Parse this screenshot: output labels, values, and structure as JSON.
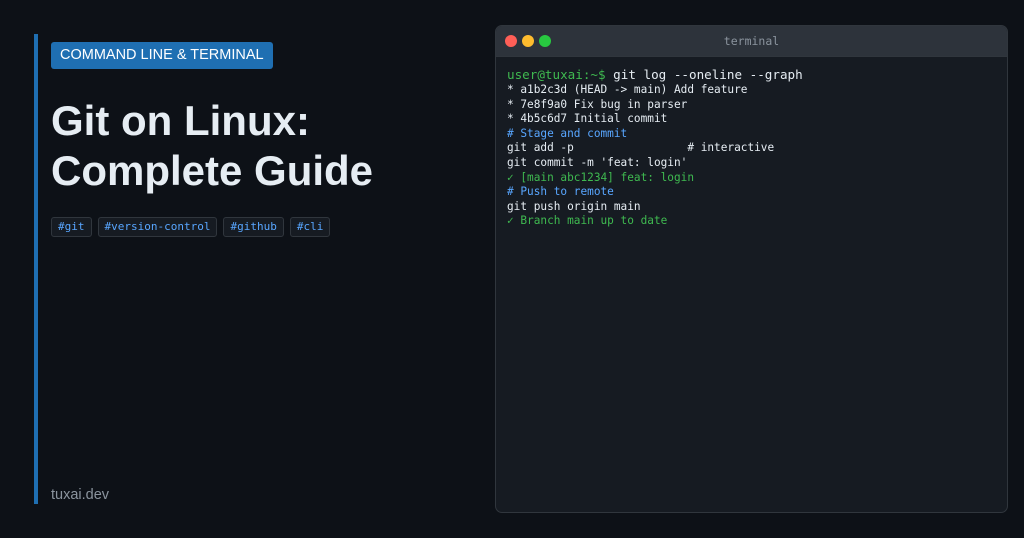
{
  "header": {
    "category": "COMMAND LINE & TERMINAL",
    "title_line1": "Git on Linux:",
    "title_line2": "Complete Guide"
  },
  "tags": [
    "#git",
    "#version-control",
    "#github",
    "#cli"
  ],
  "footer": {
    "site": "tuxai.dev"
  },
  "terminal": {
    "title": "terminal",
    "prompt": "user@tuxai:~$",
    "command": " git log --oneline --graph",
    "lines": [
      {
        "text": "* a1b2c3d (HEAD -> main) Add feature",
        "kind": "normal"
      },
      {
        "text": "* 7e8f9a0 Fix bug in parser",
        "kind": "normal"
      },
      {
        "text": "* 4b5c6d7 Initial commit",
        "kind": "normal"
      },
      {
        "text": "# Stage and commit",
        "kind": "comment"
      },
      {
        "text": "git add -p                 # interactive",
        "kind": "normal"
      },
      {
        "text": "git commit -m 'feat: login'",
        "kind": "normal"
      },
      {
        "text": "✓ [main abc1234] feat: login",
        "kind": "ok"
      },
      {
        "text": "# Push to remote",
        "kind": "comment"
      },
      {
        "text": "git push origin main",
        "kind": "normal"
      },
      {
        "text": "✓ Branch main up to date",
        "kind": "ok"
      }
    ]
  },
  "colors": {
    "background": "#0d1117",
    "accent": "#1f6fb2",
    "prompt_green": "#3fb950",
    "comment_blue": "#58a6ff",
    "text": "#e6edf3",
    "muted": "#8b949e"
  }
}
